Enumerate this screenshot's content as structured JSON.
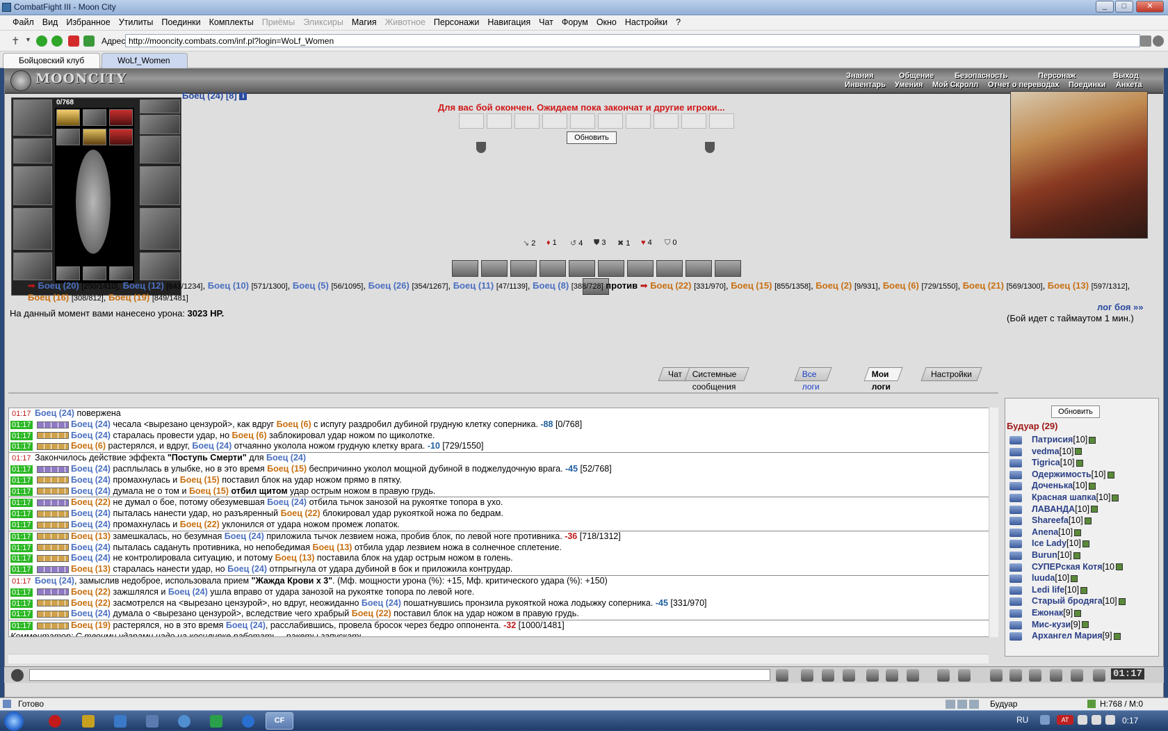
{
  "window": {
    "title": "CombatFight III - Moon City"
  },
  "menu": [
    "Файл",
    "Вид",
    "Избранное",
    "Утилиты",
    "Поединки",
    "Комплекты",
    "Приёмы",
    "Эликсиры",
    "Магия",
    "Животное",
    "Персонажи",
    "Навигация",
    "Чат",
    "Форум",
    "Окно",
    "Настройки",
    "?"
  ],
  "menu_disabled": [
    "Приёмы",
    "Эликсиры",
    "Животное"
  ],
  "address": {
    "label": "Адрес:",
    "url": "http://mooncity.combats.com/inf.pl?login=WoLf_Women"
  },
  "tabs": [
    {
      "label": "Бойцовский клуб",
      "active": true
    },
    {
      "label": "WoLf_Women",
      "active": false
    }
  ],
  "game": {
    "logo": "MOONCITY",
    "nav_top": [
      "Знания",
      "Общение",
      "Безопасность",
      "Персонаж",
      "Выход"
    ],
    "nav_bottom": [
      "Инвентарь",
      "Умения",
      "Мой Скролл",
      "Отчет о переводах",
      "Поединки",
      "Анкета"
    ],
    "hp": "0/768",
    "player": "Боец (24) [8]",
    "battle_message": "Для вас бой окончен. Ожидаем пока закончат и другие игроки...",
    "refresh": "Обновить",
    "stats": [
      "2",
      "1",
      "4",
      "3",
      "1",
      "4",
      "0"
    ],
    "versus": "против",
    "team1": [
      [
        "Боец (20)",
        "[250/1410]"
      ],
      [
        "Боец (12)",
        "[643/1234]"
      ],
      [
        "Боец (10)",
        "[571/1300]"
      ],
      [
        "Боец (5)",
        "[56/1095]"
      ],
      [
        "Боец (26)",
        "[354/1267]"
      ],
      [
        "Боец (11)",
        "[47/1139]"
      ],
      [
        "Боец (8)",
        "[388/728]"
      ]
    ],
    "team2": [
      [
        "Боец (22)",
        "[331/970]"
      ],
      [
        "Боец (15)",
        "[855/1358]"
      ],
      [
        "Боец (2)",
        "[9/931]"
      ],
      [
        "Боец (6)",
        "[729/1550]"
      ],
      [
        "Боец (21)",
        "[569/1300]"
      ],
      [
        "Боец (13)",
        "[597/1312]"
      ],
      [
        "Боец (16)",
        "[308/812]"
      ],
      [
        "Боец (19)",
        "[849/1481]"
      ]
    ],
    "damage_text": "На данный момент вами нанесено урона:",
    "damage_value": "3023 HP.",
    "log_link": "лог боя »»",
    "timeout": "(Бой идет с таймаутом 1 мин.)"
  },
  "chat_tabs": [
    "Чат",
    "Системные сообщения",
    "Все логи",
    "Мои логи",
    "Настройки"
  ],
  "log_rows": [
    {
      "t": "01:17",
      "g": false,
      "r": true,
      "html": "<b class='tb'>Боец (24)</b> повержена"
    },
    {
      "t": "01:17",
      "g": true,
      "sq": "b",
      "html": "<b class='tb'>Боец (24)</b> чесала &lt;вырезано цензурой&gt;, как вдруг <b class='to'>Боец (6)</b> с испугу раздробил дубиной грудную клетку соперника. <span class='blu'>-88</span> [0/768]"
    },
    {
      "t": "01:17",
      "g": true,
      "sq": "o",
      "html": "<b class='tb'>Боец (24)</b> старалась провести удар, но <b class='to'>Боец (6)</b> заблокировал удар ножом по щиколотке."
    },
    {
      "t": "01:17",
      "g": true,
      "sq": "o",
      "html": "<b class='to'>Боец (6)</b> растерялся, и вдруг, <b class='tb'>Боец (24)</b> отчаянно уколола ножом грудную клетку врага. <span class='blu'>-10</span> [729/1550]",
      "div": true
    },
    {
      "t": "01:17",
      "g": false,
      "r": true,
      "html": "Закончилось действие эффекта <b>\"Поступь Смерти\"</b> для <b class='tb'>Боец (24)</b>"
    },
    {
      "t": "01:17",
      "g": true,
      "sq": "b",
      "html": "<b class='tb'>Боец (24)</b> расплылась в улыбке, но в это время <b class='to'>Боец (15)</b> беспричинно уколол мощной дубиной в поджелудочную врага. <span class='blu'>-45</span> [52/768]"
    },
    {
      "t": "01:17",
      "g": true,
      "sq": "o",
      "html": "<b class='tb'>Боец (24)</b> промахнулась и <b class='to'>Боец (15)</b> поставил блок на удар ножом прямо в пятку."
    },
    {
      "t": "01:17",
      "g": true,
      "sq": "o",
      "html": "<b class='tb'>Боец (24)</b> думала не о том и <b class='to'>Боец (15)</b> <b>отбил щитом</b> удар острым ножом в правую грудь.",
      "div": true
    },
    {
      "t": "01:17",
      "g": true,
      "sq": "b",
      "html": "<b class='to'>Боец (22)</b> не думал о бое, потому обезумевшая <b class='tb'>Боец (24)</b> отбила тычок занозой на рукоятке топора в ухо."
    },
    {
      "t": "01:17",
      "g": true,
      "sq": "o",
      "html": "<b class='tb'>Боец (24)</b> пыталась нанести удар, но разъяренный <b class='to'>Боец (22)</b> блокировал удар рукояткой ножа по бедрам."
    },
    {
      "t": "01:17",
      "g": true,
      "sq": "o",
      "html": "<b class='tb'>Боец (24)</b> промахнулась и <b class='to'>Боец (22)</b> уклонился от удара ножом промеж лопаток.",
      "div": true
    },
    {
      "t": "01:17",
      "g": true,
      "sq": "o",
      "html": "<b class='to'>Боец (13)</b> замешкалась, но безумная <b class='tb'>Боец (24)</b> приложила тычок лезвием ножа, пробив блок, по левой ноге противника. <span class='neg'>-36</span> [718/1312]"
    },
    {
      "t": "01:17",
      "g": true,
      "sq": "o",
      "html": "<b class='tb'>Боец (24)</b> пыталась садануть противника, но непобедимая <b class='to'>Боец (13)</b> отбила удар лезвием ножа в солнечное сплетение."
    },
    {
      "t": "01:17",
      "g": true,
      "sq": "o",
      "html": "<b class='tb'>Боец (24)</b> не контролировала ситуацию, и потому <b class='to'>Боец (13)</b> поставила блок на удар острым ножом в голень."
    },
    {
      "t": "01:17",
      "g": true,
      "sq": "b",
      "html": "<b class='to'>Боец (13)</b> старалась нанести удар, но <b class='tb'>Боец (24)</b> отпрыгнула от удара дубиной в бок и приложила контрудар.",
      "div": true
    },
    {
      "t": "01:17",
      "g": false,
      "r": true,
      "html": "<b class='tb'>Боец (24)</b>, замыслив недоброе, использовала прием <b>\"Жажда Крови x 3\"</b>. (Мф. мощности урона (%): +15, Мф. критического удара (%): +150)"
    },
    {
      "t": "01:17",
      "g": true,
      "sq": "b",
      "html": "<b class='to'>Боец (22)</b> зажшлялся и <b class='tb'>Боец (24)</b> ушла вправо от удара занозой на рукоятке топора по левой ноге."
    },
    {
      "t": "01:17",
      "g": true,
      "sq": "o",
      "html": "<b class='to'>Боец (22)</b> засмотрелся на &lt;вырезано цензурой&gt;, но вдруг, неожиданно <b class='tb'>Боец (24)</b> пошатнувшись пронзила рукояткой ножа лодыжку соперника. <span class='blu'>-45</span> [331/970]"
    },
    {
      "t": "01:17",
      "g": true,
      "sq": "o",
      "html": "<b class='tb'>Боец (24)</b> думала о &lt;вырезано цензурой&gt;, вследствие чего храбрый <b class='to'>Боец (22)</b> поставил блок на удар ножом в правую грудь.",
      "div": true
    },
    {
      "t": "01:17",
      "g": true,
      "sq": "o",
      "html": "<b class='to'>Боец (19)</b> растерялся, но в это время <b class='tb'>Боец (24)</b>, расслабившись, провела бросок через бедро оппонента. <span class='neg'>-32</span> [1000/1481]"
    },
    {
      "t": "",
      "g": false,
      "html": "<i>Комментатор: С твоими ударами надо на косилирке работать... ракеты запускать</i>"
    }
  ],
  "side": {
    "refresh": "Обновить",
    "title": "Будуар (29)",
    "users": [
      [
        "Патрисия",
        "[10]"
      ],
      [
        "vedma",
        "[10]"
      ],
      [
        "Tigrica",
        "[10]"
      ],
      [
        "Одержимость",
        "[10]"
      ],
      [
        "Доченька",
        "[10]"
      ],
      [
        "Красная шапка",
        "[10]"
      ],
      [
        "ЛАВАНДА",
        "[10]"
      ],
      [
        "Shareefa",
        "[10]"
      ],
      [
        "Anena",
        "[10]"
      ],
      [
        "Ice Lady",
        "[10]"
      ],
      [
        "Burun",
        "[10]"
      ],
      [
        "СУПЕРская Котя",
        "[10"
      ],
      [
        "luuda",
        "[10]"
      ],
      [
        "Ledi life",
        "[10]"
      ],
      [
        "Старый бродяга",
        "[10]"
      ],
      [
        "Ежонак",
        "[9]"
      ],
      [
        "Мис-кузи",
        "[9]"
      ],
      [
        "Архангел Мария",
        "[9]"
      ]
    ]
  },
  "clock": "01:17",
  "status": {
    "left": "Готово",
    "mid": "Будуар",
    "right": "H:768 / M:0"
  },
  "taskbar": {
    "lang": "RU",
    "time": "0:17"
  }
}
